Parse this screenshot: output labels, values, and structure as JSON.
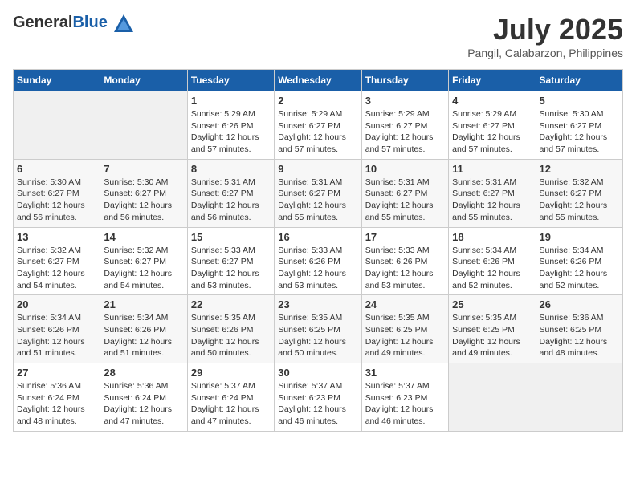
{
  "header": {
    "logo_general": "General",
    "logo_blue": "Blue",
    "month_year": "July 2025",
    "location": "Pangil, Calabarzon, Philippines"
  },
  "days_of_week": [
    "Sunday",
    "Monday",
    "Tuesday",
    "Wednesday",
    "Thursday",
    "Friday",
    "Saturday"
  ],
  "weeks": [
    [
      {
        "day": "",
        "info": ""
      },
      {
        "day": "",
        "info": ""
      },
      {
        "day": "1",
        "sunrise": "5:29 AM",
        "sunset": "6:26 PM",
        "daylight": "12 hours and 57 minutes."
      },
      {
        "day": "2",
        "sunrise": "5:29 AM",
        "sunset": "6:27 PM",
        "daylight": "12 hours and 57 minutes."
      },
      {
        "day": "3",
        "sunrise": "5:29 AM",
        "sunset": "6:27 PM",
        "daylight": "12 hours and 57 minutes."
      },
      {
        "day": "4",
        "sunrise": "5:29 AM",
        "sunset": "6:27 PM",
        "daylight": "12 hours and 57 minutes."
      },
      {
        "day": "5",
        "sunrise": "5:30 AM",
        "sunset": "6:27 PM",
        "daylight": "12 hours and 57 minutes."
      }
    ],
    [
      {
        "day": "6",
        "sunrise": "5:30 AM",
        "sunset": "6:27 PM",
        "daylight": "12 hours and 56 minutes."
      },
      {
        "day": "7",
        "sunrise": "5:30 AM",
        "sunset": "6:27 PM",
        "daylight": "12 hours and 56 minutes."
      },
      {
        "day": "8",
        "sunrise": "5:31 AM",
        "sunset": "6:27 PM",
        "daylight": "12 hours and 56 minutes."
      },
      {
        "day": "9",
        "sunrise": "5:31 AM",
        "sunset": "6:27 PM",
        "daylight": "12 hours and 55 minutes."
      },
      {
        "day": "10",
        "sunrise": "5:31 AM",
        "sunset": "6:27 PM",
        "daylight": "12 hours and 55 minutes."
      },
      {
        "day": "11",
        "sunrise": "5:31 AM",
        "sunset": "6:27 PM",
        "daylight": "12 hours and 55 minutes."
      },
      {
        "day": "12",
        "sunrise": "5:32 AM",
        "sunset": "6:27 PM",
        "daylight": "12 hours and 55 minutes."
      }
    ],
    [
      {
        "day": "13",
        "sunrise": "5:32 AM",
        "sunset": "6:27 PM",
        "daylight": "12 hours and 54 minutes."
      },
      {
        "day": "14",
        "sunrise": "5:32 AM",
        "sunset": "6:27 PM",
        "daylight": "12 hours and 54 minutes."
      },
      {
        "day": "15",
        "sunrise": "5:33 AM",
        "sunset": "6:27 PM",
        "daylight": "12 hours and 53 minutes."
      },
      {
        "day": "16",
        "sunrise": "5:33 AM",
        "sunset": "6:26 PM",
        "daylight": "12 hours and 53 minutes."
      },
      {
        "day": "17",
        "sunrise": "5:33 AM",
        "sunset": "6:26 PM",
        "daylight": "12 hours and 53 minutes."
      },
      {
        "day": "18",
        "sunrise": "5:34 AM",
        "sunset": "6:26 PM",
        "daylight": "12 hours and 52 minutes."
      },
      {
        "day": "19",
        "sunrise": "5:34 AM",
        "sunset": "6:26 PM",
        "daylight": "12 hours and 52 minutes."
      }
    ],
    [
      {
        "day": "20",
        "sunrise": "5:34 AM",
        "sunset": "6:26 PM",
        "daylight": "12 hours and 51 minutes."
      },
      {
        "day": "21",
        "sunrise": "5:34 AM",
        "sunset": "6:26 PM",
        "daylight": "12 hours and 51 minutes."
      },
      {
        "day": "22",
        "sunrise": "5:35 AM",
        "sunset": "6:26 PM",
        "daylight": "12 hours and 50 minutes."
      },
      {
        "day": "23",
        "sunrise": "5:35 AM",
        "sunset": "6:25 PM",
        "daylight": "12 hours and 50 minutes."
      },
      {
        "day": "24",
        "sunrise": "5:35 AM",
        "sunset": "6:25 PM",
        "daylight": "12 hours and 49 minutes."
      },
      {
        "day": "25",
        "sunrise": "5:35 AM",
        "sunset": "6:25 PM",
        "daylight": "12 hours and 49 minutes."
      },
      {
        "day": "26",
        "sunrise": "5:36 AM",
        "sunset": "6:25 PM",
        "daylight": "12 hours and 48 minutes."
      }
    ],
    [
      {
        "day": "27",
        "sunrise": "5:36 AM",
        "sunset": "6:24 PM",
        "daylight": "12 hours and 48 minutes."
      },
      {
        "day": "28",
        "sunrise": "5:36 AM",
        "sunset": "6:24 PM",
        "daylight": "12 hours and 47 minutes."
      },
      {
        "day": "29",
        "sunrise": "5:37 AM",
        "sunset": "6:24 PM",
        "daylight": "12 hours and 47 minutes."
      },
      {
        "day": "30",
        "sunrise": "5:37 AM",
        "sunset": "6:23 PM",
        "daylight": "12 hours and 46 minutes."
      },
      {
        "day": "31",
        "sunrise": "5:37 AM",
        "sunset": "6:23 PM",
        "daylight": "12 hours and 46 minutes."
      },
      {
        "day": "",
        "info": ""
      },
      {
        "day": "",
        "info": ""
      }
    ]
  ],
  "labels": {
    "sunrise_prefix": "Sunrise: ",
    "sunset_prefix": "Sunset: ",
    "daylight_prefix": "Daylight: "
  }
}
